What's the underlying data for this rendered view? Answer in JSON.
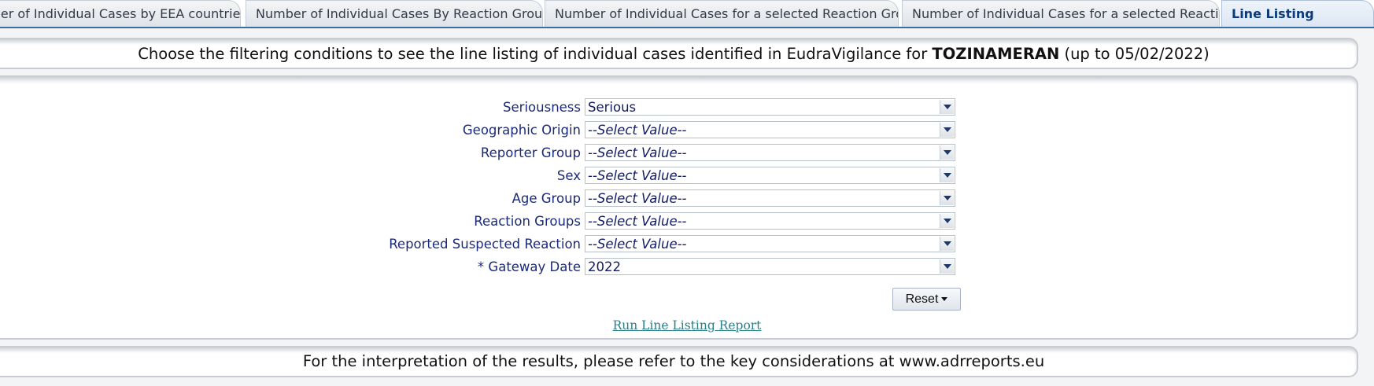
{
  "tabs": [
    {
      "label": "Number of Individual Cases by EEA countries",
      "active": false
    },
    {
      "label": "Number of Individual Cases By Reaction Groups",
      "active": false
    },
    {
      "label": "Number of Individual Cases for a selected Reaction Group",
      "active": false
    },
    {
      "label": "Number of Individual Cases for a selected Reaction",
      "active": false
    },
    {
      "label": "Line Listing",
      "active": true
    }
  ],
  "header": {
    "prefix": "Choose the filtering conditions to see the line listing of individual cases identified in EudraVigilance for ",
    "product": "TOZINAMERAN",
    "suffix": " (up to 05/02/2022)"
  },
  "filters": [
    {
      "label": "Seriousness",
      "value": "Serious",
      "placeholder": false
    },
    {
      "label": "Geographic Origin",
      "value": "--Select Value--",
      "placeholder": true
    },
    {
      "label": "Reporter Group",
      "value": "--Select Value--",
      "placeholder": true
    },
    {
      "label": "Sex",
      "value": "--Select Value--",
      "placeholder": true
    },
    {
      "label": "Age Group",
      "value": "--Select Value--",
      "placeholder": true
    },
    {
      "label": "Reaction Groups",
      "value": "--Select Value--",
      "placeholder": true
    },
    {
      "label": "Reported Suspected Reaction",
      "value": "--Select Value--",
      "placeholder": true
    },
    {
      "label": "* Gateway Date",
      "value": "2022",
      "placeholder": false
    }
  ],
  "actions": {
    "reset_label": "Reset",
    "run_label": "Run Line Listing Report"
  },
  "footer": {
    "text": "For the interpretation of the results, please refer to the key considerations at www.adrreports.eu"
  },
  "colors": {
    "label_text": "#1b2a7a",
    "tab_border": "#3a6ea5",
    "link": "#2c7f8a"
  }
}
